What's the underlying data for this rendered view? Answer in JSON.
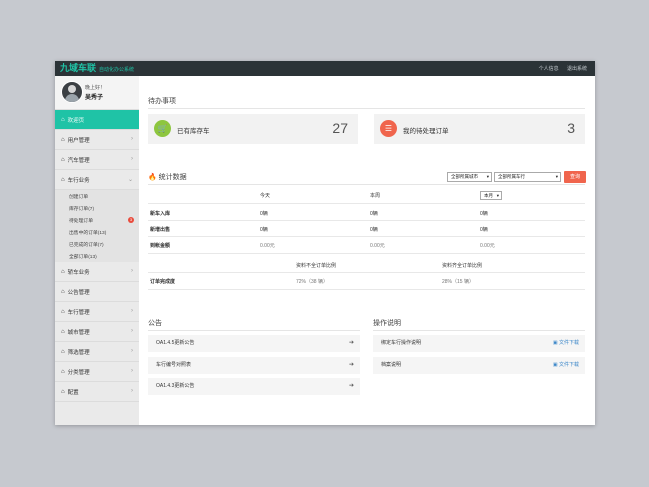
{
  "header": {
    "brand": "九域车联",
    "subtitle": "自动化办公系统",
    "links": [
      "个人信息",
      "退出系统"
    ]
  },
  "user": {
    "greeting": "晚上好！",
    "name": "吴秀子"
  },
  "sidebar": {
    "items": [
      {
        "label": "欢迎页",
        "icon": "home-icon",
        "active": true
      },
      {
        "label": "用户管理",
        "icon": "home-icon"
      },
      {
        "label": "汽车管理",
        "icon": "home-icon"
      },
      {
        "label": "车行业务",
        "icon": "home-icon",
        "expanded": true
      }
    ],
    "sub_items": [
      {
        "label": "创建订单"
      },
      {
        "label": "库存订单(7)"
      },
      {
        "label": "待处理订单",
        "badge": "3"
      },
      {
        "label": "出售中的订单(13)"
      },
      {
        "label": "已完成的订单(7)"
      },
      {
        "label": "全部订单(13)"
      }
    ],
    "items_after": [
      {
        "label": "轿车业务",
        "icon": "home-icon"
      },
      {
        "label": "公告管理",
        "icon": "home-icon"
      },
      {
        "label": "车行管理",
        "icon": "home-icon"
      },
      {
        "label": "城市管理",
        "icon": "home-icon"
      },
      {
        "label": "筛选管理",
        "icon": "home-icon"
      },
      {
        "label": "分类管理",
        "icon": "home-icon"
      },
      {
        "label": "配置",
        "icon": "home-icon"
      }
    ]
  },
  "todo": {
    "title": "待办事项",
    "cards": [
      {
        "label": "已有库存车",
        "value": "27",
        "icon": "cart-icon",
        "color": "#8dc63f"
      },
      {
        "label": "我的待处理订单",
        "value": "3",
        "icon": "list-icon",
        "color": "#f0654d"
      }
    ]
  },
  "stats": {
    "title": "统计数据",
    "city_select": "全部所属城市",
    "shop_select": "全部所属车行",
    "query_button": "查询",
    "columns": [
      "今天",
      "本周"
    ],
    "month_select": "本月",
    "rows": [
      {
        "label": "新车入库",
        "values": [
          "0辆",
          "0辆",
          "0辆"
        ]
      },
      {
        "label": "新增出售",
        "values": [
          "0辆",
          "0辆",
          "0辆"
        ]
      },
      {
        "label": "到帐金额",
        "values": [
          "0.00元",
          "0.00元",
          "0.00元"
        ]
      }
    ],
    "ratio_headers": [
      "资料不全订单比例",
      "资料齐全订单比例"
    ],
    "ratio_row": {
      "label": "订单完成度",
      "values": [
        "72%（38 辆）",
        "28%（15 辆）"
      ]
    }
  },
  "notices": {
    "title": "公告",
    "items": [
      "OA1.4.5更新公告",
      "车行编号对照表",
      "OA1.4.3更新公告"
    ]
  },
  "instructions": {
    "title": "操作说明",
    "items": [
      {
        "label": "绑定车行操作说明",
        "action": "文件下载"
      },
      {
        "label": "档案说明",
        "action": "文件下载"
      }
    ]
  }
}
